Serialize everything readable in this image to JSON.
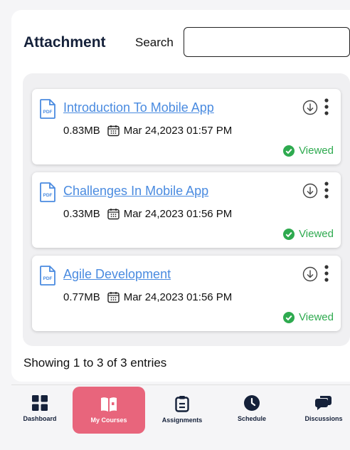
{
  "header": {
    "title": "Attachment",
    "search_label": "Search",
    "search_value": "",
    "search_placeholder": ""
  },
  "attachments": [
    {
      "name": "Introduction To Mobile App",
      "size": "0.83MB",
      "date": "Mar 24,2023 01:57 PM",
      "status": "Viewed"
    },
    {
      "name": "Challenges In Mobile App",
      "size": "0.33MB",
      "date": "Mar 24,2023 01:56 PM",
      "status": "Viewed"
    },
    {
      "name": "Agile Development",
      "size": "0.77MB",
      "date": "Mar 24,2023 01:56 PM",
      "status": "Viewed"
    }
  ],
  "footer": {
    "entries_text": "Showing 1 to 3 of 3 entries"
  },
  "tabs": [
    {
      "label": "Dashboard",
      "icon": "grid-icon",
      "active": false
    },
    {
      "label": "My Courses",
      "icon": "book-icon",
      "active": true
    },
    {
      "label": "Assignments",
      "icon": "clipboard-icon",
      "active": false
    },
    {
      "label": "Schedule",
      "icon": "clock-icon",
      "active": false
    },
    {
      "label": "Discussions",
      "icon": "chat-bubbles-icon",
      "active": false
    }
  ],
  "colors": {
    "link": "#4a8be0",
    "viewed": "#2eaa4f",
    "active_tab": "#e8657c",
    "nav_icon": "#15213a",
    "pdf_icon": "#4a8be0"
  }
}
